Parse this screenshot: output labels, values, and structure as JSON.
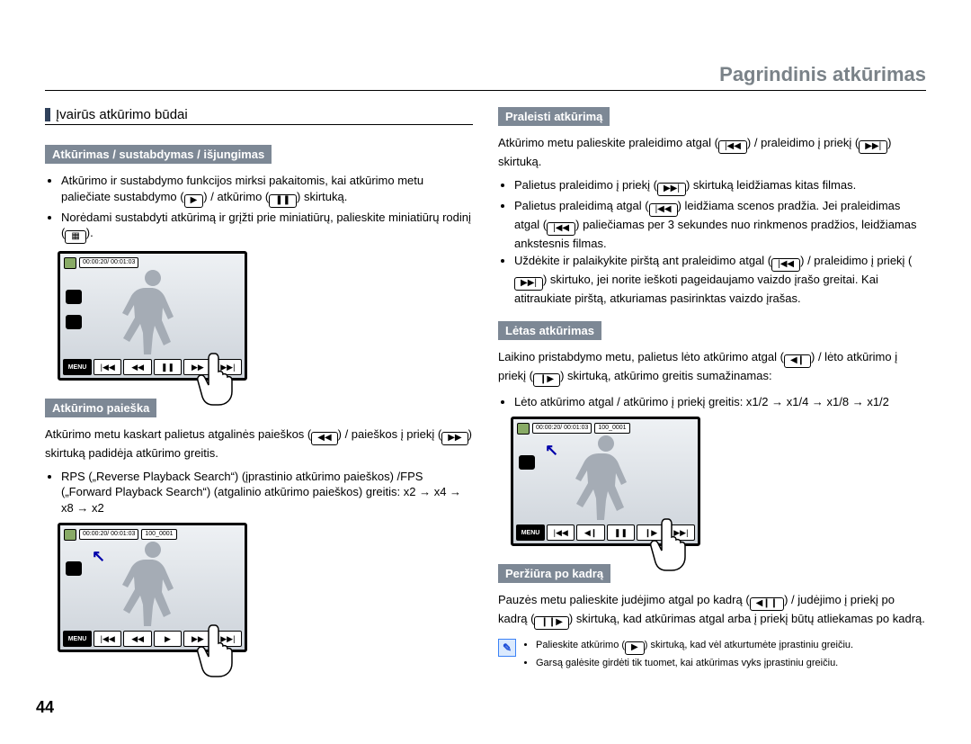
{
  "page_title": "Pagrindinis atkūrimas",
  "page_number": "44",
  "section_heading": "Įvairūs atkūrimo būdai",
  "left": {
    "sub1": "Atkūrimas / sustabdymas / išjungimas",
    "b1": "Atkūrimo ir sustabdymo funkcijos mirksi pakaitomis, kai atkūrimo metu paliečiate sustabdymo (",
    "b1b": ") / atkūrimo (",
    "b1c": ") skirtuką.",
    "b2": "Norėdami sustabdyti atkūrimą ir grįžti prie miniatiūrų, palieskite miniatiūrų rodinį (",
    "b2b": ").",
    "sub2": "Atkūrimo paieška",
    "p2": "Atkūrimo metu kaskart palietus atgalinės paieškos (",
    "p2b": ") / paieškos į priekį (",
    "p2c": ") skirtuką padidėja atkūrimo greitis.",
    "b3": "RPS („Reverse Playback Search“) (įprastinio atkūrimo paieškos) /FPS („Forward Playback Search“) (atgalinio atkūrimo paieškos) greitis: x2 → x4 → x8 → x2"
  },
  "right": {
    "sub3": "Praleisti atkūrimą",
    "p3": "Atkūrimo metu palieskite praleidimo atgal (",
    "p3b": ") / praleidimo į priekį (",
    "p3c": ") skirtuką.",
    "b4": "Palietus praleidimo į priekį (",
    "b4b": ") skirtuką leidžiamas kitas filmas.",
    "b5": "Palietus praleidimą atgal (",
    "b5b": ") leidžiama scenos pradžia. Jei praleidimas atgal (",
    "b5c": ") paliečiamas per 3 sekundes nuo rinkmenos pradžios, leidžiamas ankstesnis filmas.",
    "b6": "Uždėkite ir palaikykite pirštą ant praleidimo atgal (",
    "b6b": ") / praleidimo į priekį (",
    "b6c": ") skirtuko, jei norite ieškoti pageidaujamo vaizdo įrašo greitai. Kai atitraukiate pirštą, atkuriamas pasirinktas vaizdo įrašas.",
    "sub4": "Lėtas atkūrimas",
    "p4": "Laikino pristabdymo metu, palietus lėto atkūrimo atgal (",
    "p4b": ") / lėto atkūrimo į priekį (",
    "p4c": ") skirtuką, atkūrimo greitis sumažinamas:",
    "b7": "Lėto atkūrimo atgal / atkūrimo į priekį greitis: x1/2 → x1/4 → x1/8 → x1/2",
    "sub5": "Peržiūra po kadrą",
    "p5": "Pauzės metu palieskite judėjimo atgal po kadrą (",
    "p5b": ") / judėjimo į priekį po kadrą (",
    "p5c": ") skirtuką, kad atkūrimas atgal arba į priekį būtų atliekamas po kadrą."
  },
  "note": {
    "n1a": "Palieskite atkūrimo (",
    "n1b": ") skirtuką, kad vėl atkurtumėte įprastiniu greičiu.",
    "n2": "Garsą galėsite girdėti tik tuomet, kai atkūrimas vyks įprastiniu greičiu."
  },
  "lcd": {
    "time": "00:00:20/ 00:01:03",
    "clip": "100_0001",
    "menu": "MENU"
  }
}
